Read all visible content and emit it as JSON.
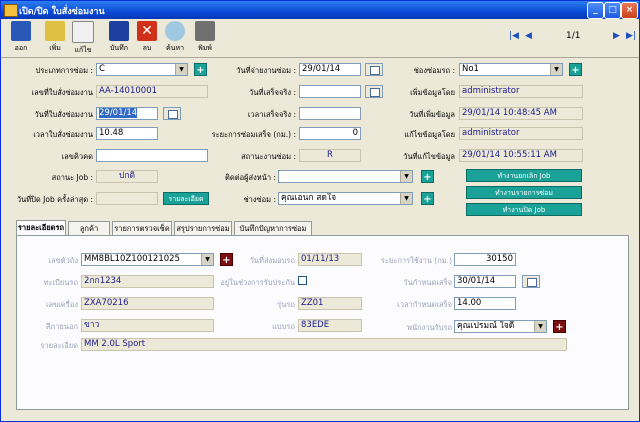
{
  "window": {
    "title": "เปิด/ปิด ใบสั่งซ่อมงาน"
  },
  "toolbar": {
    "buttons": [
      {
        "label": "ออก",
        "icon": "exit-icon",
        "color": "#2a58b8"
      },
      {
        "label": "เพิ่ม",
        "icon": "add-note-icon",
        "color": "#e0c040"
      },
      {
        "label": "แก้ไข",
        "icon": "edit-document-icon",
        "color": "#f0f0f0"
      },
      {
        "label": "บันทึก",
        "icon": "save-disk-icon",
        "color": "#1c3fa0"
      },
      {
        "label": "ลบ",
        "icon": "delete-x-icon",
        "color": "#d03018"
      },
      {
        "label": "ค้นหา",
        "icon": "magnifier-icon",
        "color": "#a0c8e0"
      },
      {
        "label": "พิมพ์",
        "icon": "printer-icon",
        "color": "#707070"
      }
    ],
    "page_indicator": "1/1"
  },
  "form": {
    "repair_type": {
      "label": "ประเภทการซ่อม :",
      "value": "C"
    },
    "job_number": {
      "label": "เลขที่ใบสั่งซ่อมงาน",
      "value": "AA-14010001"
    },
    "order_date": {
      "label": "วันที่ใบสั่งซ่อมงาน",
      "value": "29/01/14"
    },
    "order_time": {
      "label": "เวลาใบสั่งซ่อมงาน",
      "value": "10.48"
    },
    "queue_no": {
      "label": "เลขคิวคด",
      "value": ""
    },
    "job_status": {
      "label": "สถานะ Job :",
      "value": "ปกติ"
    },
    "last_closed": {
      "label": "วันที่ปิด Job ครั้งล่าสุด :",
      "value": "",
      "button": "รายละเอียด"
    },
    "repair_date": {
      "label": "วันที่จ่ายงานซ่อม :",
      "value": "29/01/14"
    },
    "finish_date": {
      "label": "วันที่เสร็จจริง :",
      "value": ""
    },
    "finish_time": {
      "label": "เวลาเสร็จจริง :",
      "value": ""
    },
    "distance": {
      "label": "ระยะการซ่อมเสร็จ (กม.) :",
      "value": "0"
    },
    "repair_status": {
      "label": "สถานะงานซ่อม :",
      "value": "R"
    },
    "contact_person": {
      "label": "ติดต่อผู้ส่งหน้า :",
      "value": ""
    },
    "mechanic": {
      "label": "ช่างซ่อม :",
      "value": "คุณเอนก  สดใจ"
    },
    "repair_channel": {
      "label": "ช่องซ่อมรถ :",
      "value": "No1"
    },
    "created_by": {
      "label": "เพิ่มข้อมูลโดย",
      "value": "administrator"
    },
    "created_date": {
      "label": "วันที่เพิ่มข้อมูล",
      "value": "29/01/14 10:48:45 AM"
    },
    "updated_by": {
      "label": "แก้ไขข้อมูลโดย",
      "value": "administrator"
    },
    "updated_date": {
      "label": "วันที่แก้ไขข้อมูล",
      "value": "29/01/14 10:55:11 AM"
    },
    "action_buttons": [
      "ทำงานยกเลิก Job",
      "ทำงานรายการซ่อม",
      "ทำงานปิด Job"
    ]
  },
  "tabs": [
    "รายละเอียดรถ",
    "ลูกค้า",
    "รายการตรวจเช็ค",
    "สรุปรายการซ่อม",
    "บันทึกปัญหาการซ่อม"
  ],
  "vehicle": {
    "body_no": {
      "label": "เลขตัวถัง",
      "value": "MM8BL10Z100121025"
    },
    "plate": {
      "label": "ทะเบียนรถ",
      "value": "2กก1234"
    },
    "engine_no": {
      "label": "เลขเครื่อง",
      "value": "ZXA70216"
    },
    "color": {
      "label": "สีภายนอก",
      "value": "ขาว"
    },
    "detail": {
      "label": "รายละเอียด",
      "value": "MM 2.0L Sport"
    },
    "insure_date": {
      "label": "วันที่ส่งมอบรถ",
      "value": "01/11/13"
    },
    "wait_in_shop": {
      "label": "อยู่ในช่วงการรับประกัน"
    },
    "model": {
      "label": "รุ่นรถ",
      "value": "ZZ01"
    },
    "type": {
      "label": "แบบรถ",
      "value": "83EDE"
    },
    "mileage": {
      "label": "ระยะการใช้งาน (กม.)",
      "value": "30150"
    },
    "appoint_date": {
      "label": "วันกำหนดเสร็จ",
      "value": "30/01/14"
    },
    "appoint_time": {
      "label": "เวลากำหนดเสร็จ",
      "value": "14.00"
    },
    "advisor": {
      "label": "พนักงานรับรถ",
      "value": "คุณเปรมณ์ ใจดี"
    }
  }
}
